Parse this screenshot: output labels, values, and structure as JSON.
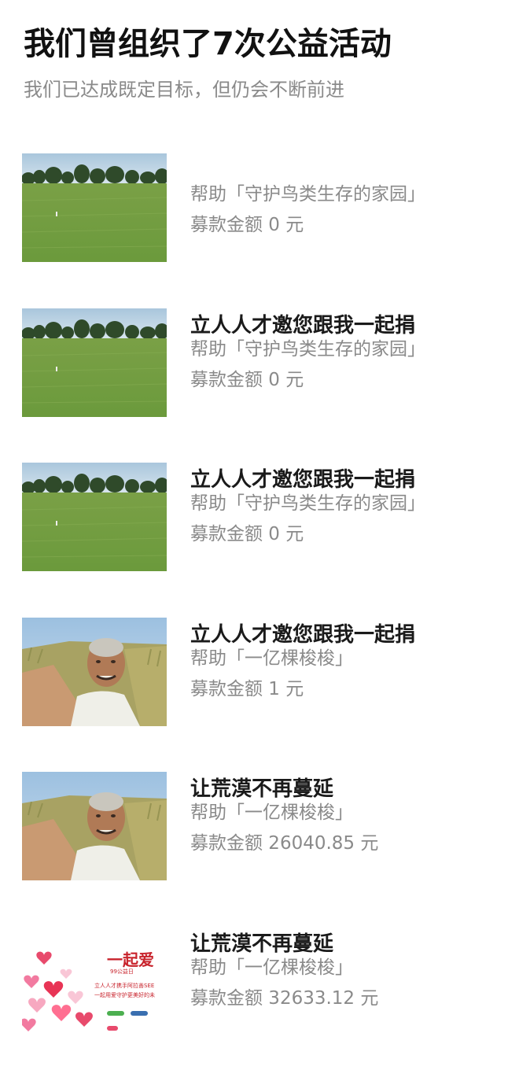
{
  "header": {
    "title": "我们曾组织了7次公益活动",
    "subtitle": "我们已达成既定目标，但仍会不断前进"
  },
  "activities": [
    {
      "title": "",
      "help": "帮助「守护鸟类生存的家园」",
      "amount": "募款金额 0 元",
      "thumbnail": "grassland-photo"
    },
    {
      "title": "立人人才邀您跟我一起捐",
      "help": "帮助「守护鸟类生存的家园」",
      "amount": "募款金额 0 元",
      "thumbnail": "grassland-photo"
    },
    {
      "title": "立人人才邀您跟我一起捐",
      "help": "帮助「守护鸟类生存的家园」",
      "amount": "募款金额 0 元",
      "thumbnail": "grassland-photo"
    },
    {
      "title": "立人人才邀您跟我一起捐",
      "help": "帮助「一亿棵梭梭」",
      "amount": "募款金额 1 元",
      "thumbnail": "elderly-man-desert-photo"
    },
    {
      "title": "让荒漠不再蔓延",
      "help": "帮助「一亿棵梭梭」",
      "amount": "募款金额 26040.85 元",
      "thumbnail": "elderly-man-desert-photo"
    },
    {
      "title": "让荒漠不再蔓延",
      "help": "帮助「一亿棵梭梭」",
      "amount": "募款金额 32633.12 元",
      "thumbnail": "charity-poster-hearts",
      "poster": {
        "logo_text": "一起爱",
        "date_text": "99公益日",
        "line1": "立人人才携手阿拉善SEE",
        "line2": "一起用爱守护更美好的未"
      }
    }
  ]
}
